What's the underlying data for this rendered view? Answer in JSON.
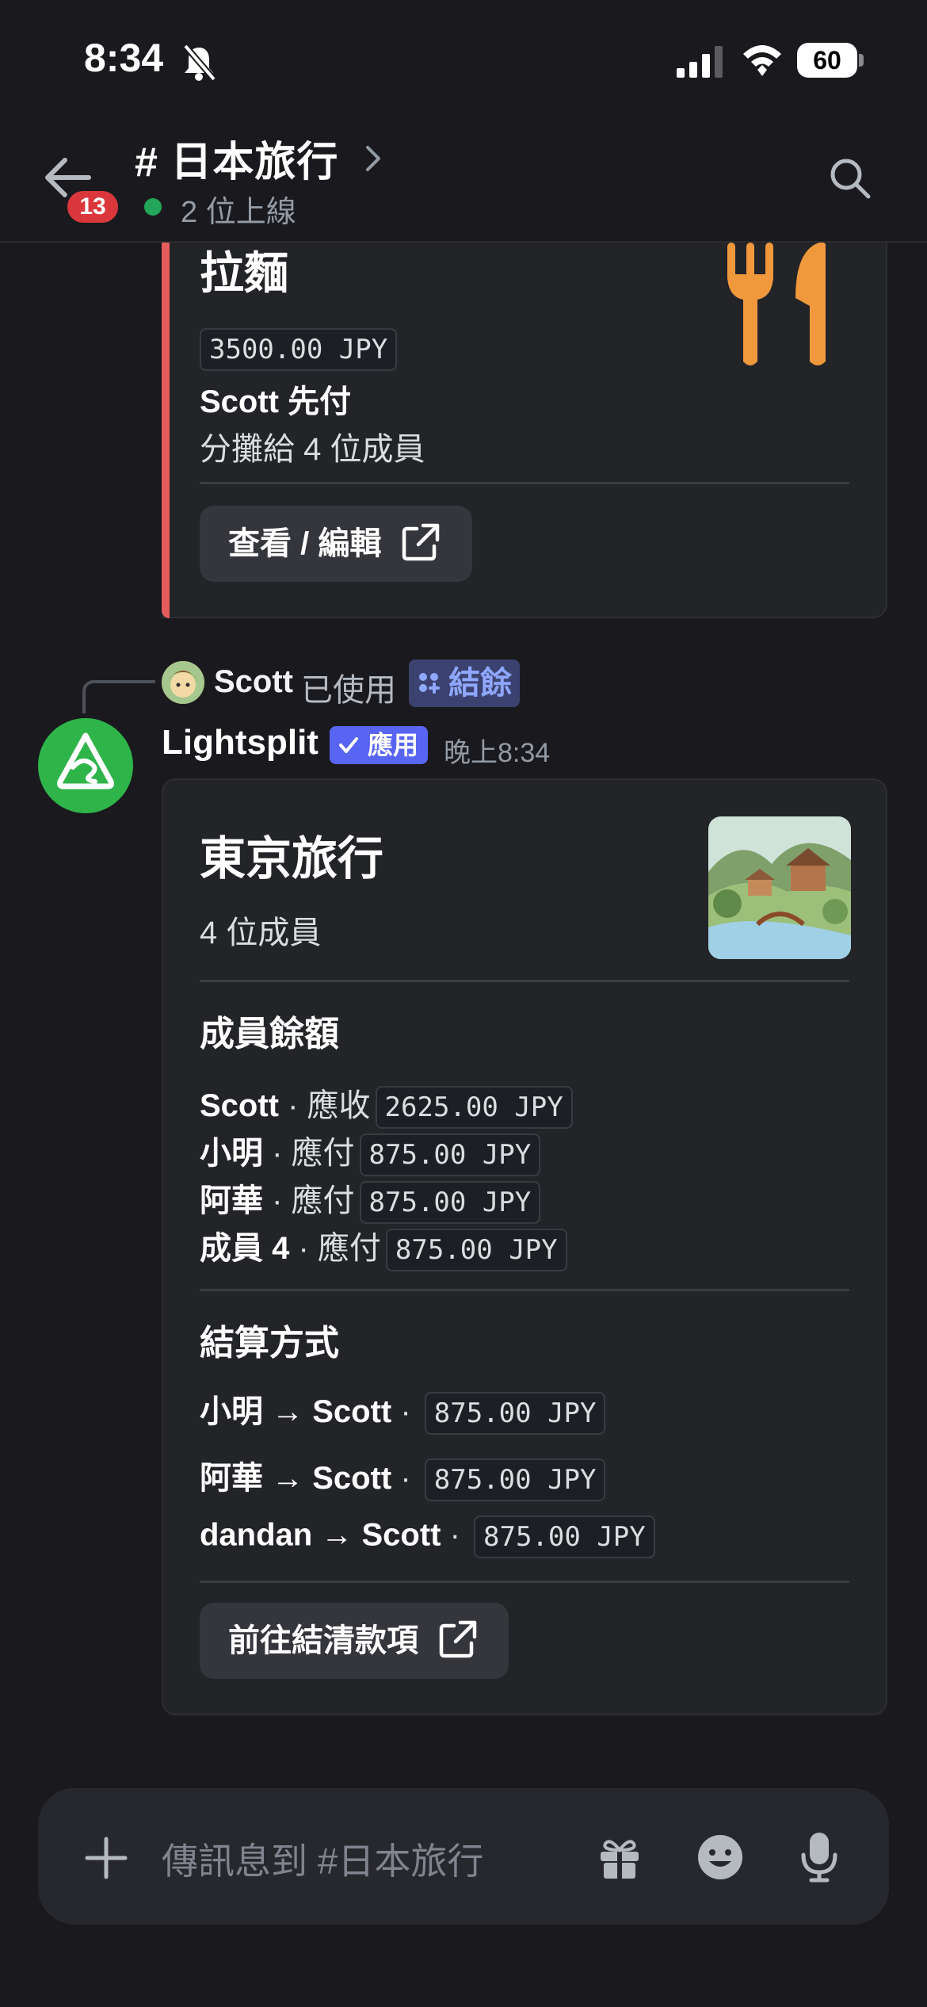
{
  "status_bar": {
    "time": "8:34",
    "battery": "60"
  },
  "header": {
    "channel_title": "# 日本旅行",
    "unread_count": "13",
    "online_text": "2 位上線"
  },
  "prev_embed": {
    "title": "拉麵",
    "amount": "3500.00 JPY",
    "payer": "Scott 先付",
    "split_text": "分攤給 4 位成員",
    "edit_button": "查看 / 編輯",
    "accent_color": "#e45c5c"
  },
  "reply": {
    "user": "Scott",
    "used_text": "已使用",
    "command": "結餘"
  },
  "message": {
    "bot_name": "Lightsplit",
    "app_badge": "應用",
    "time": "晚上8:34"
  },
  "embed": {
    "title": "東京旅行",
    "members": "4 位成員",
    "balances_title": "成員餘額",
    "balances": [
      {
        "name": "Scott",
        "action": " · 應收",
        "amount": "2625.00 JPY"
      },
      {
        "name": "小明",
        "action": " · 應付",
        "amount": "875.00 JPY"
      },
      {
        "name": "阿華",
        "action": " · 應付",
        "amount": "875.00 JPY"
      },
      {
        "name": "成員 4",
        "action": " · 應付",
        "amount": "875.00 JPY"
      }
    ],
    "settle_title": "結算方式",
    "settlements": [
      {
        "from_to": "小明 → Scott",
        "sep": " · ",
        "amount": "875.00 JPY"
      },
      {
        "from_to": "阿華 → Scott",
        "sep": " · ",
        "amount": "875.00 JPY"
      },
      {
        "from_to": "dandan → Scott",
        "sep": " · ",
        "amount": "875.00 JPY"
      }
    ],
    "settle_button": "前往結清款項"
  },
  "composer": {
    "placeholder": "傳訊息到 #日本旅行"
  },
  "icons": {
    "back": "back-arrow-icon",
    "search": "search-icon",
    "plus": "plus-icon",
    "gift": "gift-icon",
    "emoji": "emoji-icon",
    "mic": "microphone-icon",
    "external": "external-link-icon"
  },
  "colors": {
    "background": "#1a1a1e",
    "embed_bg": "#232428",
    "blurple": "#5865f2",
    "online": "#23a55a",
    "badge_red": "#da373c",
    "bot_green": "#2fb44a",
    "utensils_orange": "#f0983c"
  }
}
